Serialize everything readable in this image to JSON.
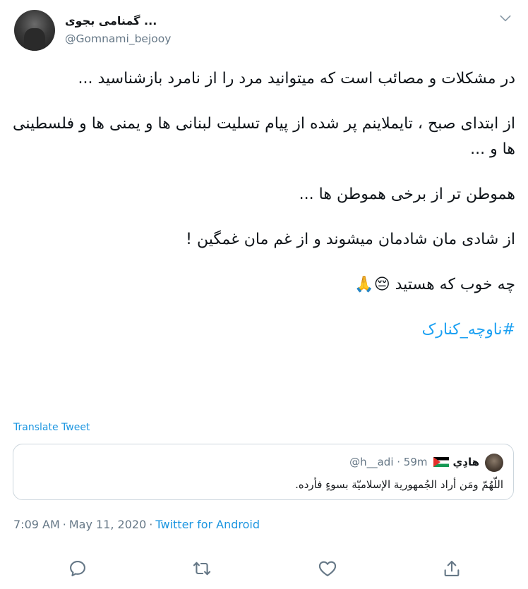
{
  "author": {
    "display_name": "گمنامی بجوی ...",
    "handle": "@Gomnami_bejooy"
  },
  "tweet": {
    "paragraphs": [
      "در مشکلات و مصائب است که میتوانید مرد را از نامرد بازشناسید ...",
      "از ابتدای صبح ، تایملاینم پر شده از پیام تسلیت لبنانی ها و یمنی ها و فلسطینی ها و ...",
      "هموطن تر از برخی هموطن ها ...",
      "از شادی مان شادمان میشوند و از غم مان غمگین !",
      "چه خوب که هستید"
    ],
    "emojis": "😔🙏",
    "hashtag": "#ناوچه_کنارک"
  },
  "translate_label": "Translate Tweet",
  "quoted": {
    "name": "هادِي",
    "handle": "@h__adi",
    "time": "· 59m",
    "text": "اللّهُمّ ومَن أراد الجُمهورية الإسلاميّة بسوءٍ فأرده."
  },
  "meta": {
    "time": "7:09 AM",
    "separator": "·",
    "date": "May 11, 2020",
    "source": "Twitter for Android"
  },
  "icons": {
    "caret": "chevron-down-icon",
    "reply": "reply-icon",
    "retweet": "retweet-icon",
    "like": "heart-icon",
    "share": "share-icon"
  },
  "colors": {
    "link": "#1b95e0",
    "muted": "#657786",
    "border": "#ccd6dd"
  }
}
